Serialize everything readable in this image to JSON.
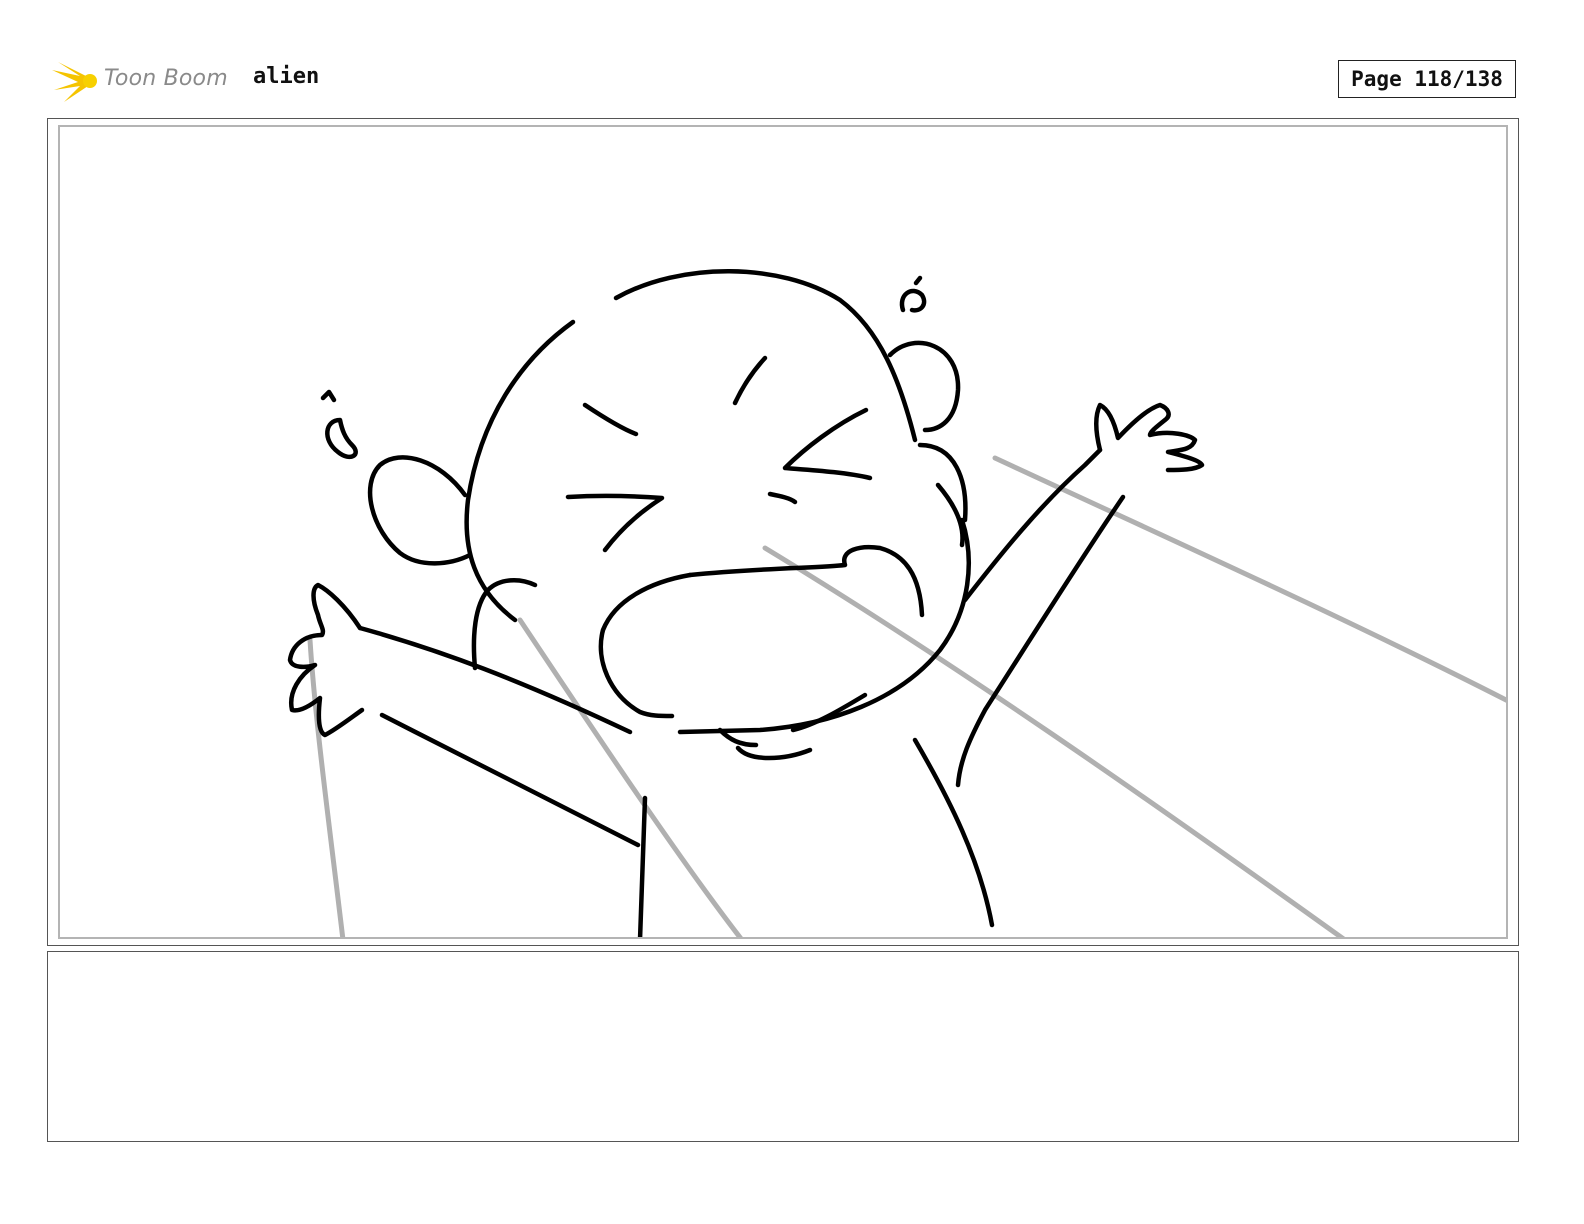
{
  "header": {
    "brand_name": "Toon Boom",
    "brand_color": "#f5c400",
    "project_title": "alien",
    "page_indicator": "Page 118/138"
  },
  "panel": {
    "description_icon": "character-sketch",
    "stroke_color": "#000000",
    "guide_line_color": "#b0b0b0"
  },
  "notes": {
    "text": ""
  }
}
